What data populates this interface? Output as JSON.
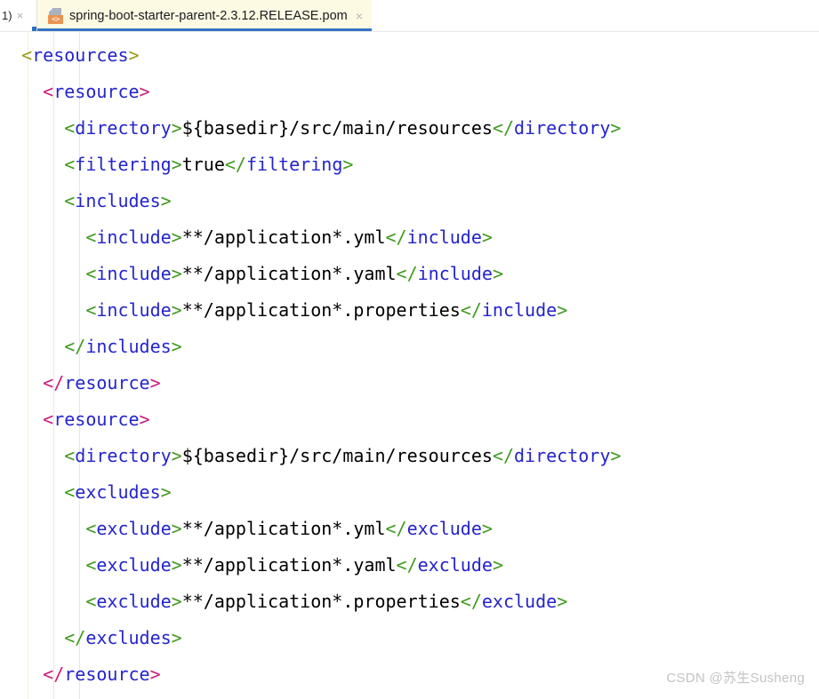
{
  "tabbar": {
    "partial_tab": {
      "label": "1)",
      "close_label": "×"
    },
    "active_tab": {
      "title": "spring-boot-starter-parent-2.3.12.RELEASE.pom",
      "icon": "xml-file-icon",
      "icon_badge": "<>",
      "close_label": "×",
      "background": "#fdfae4",
      "underline_color": "#3574c6"
    }
  },
  "editor": {
    "language": "xml",
    "colors": {
      "bracket_level0": "#9a9a18",
      "bracket_level1": "#cc1a7a",
      "bracket_level2": "#3f9a1e",
      "tag_name": "#2424cc",
      "text_content": "#000000",
      "background": "#ffffff"
    },
    "indent_guides": [
      {
        "name": "guide-level-0",
        "x": 31,
        "color": "#eff0d8"
      },
      {
        "name": "guide-level-1",
        "x": 60,
        "color": "#f5dff0"
      },
      {
        "name": "guide-level-2",
        "x": 89,
        "color": "#deeedd"
      }
    ],
    "lines": [
      {
        "indent": "",
        "open_br": "<",
        "open_tag": "resources",
        "close_br": ">",
        "level": 0
      },
      {
        "indent": "  ",
        "open_br": "<",
        "open_tag": "resource",
        "close_br": ">",
        "level": 1
      },
      {
        "indent": "    ",
        "open_br": "<",
        "open_tag": "directory",
        "close_br": ">",
        "value": "${basedir}/src/main/resources",
        "end_br_open": "</",
        "end_tag": "directory",
        "end_br_close": ">",
        "level": 2
      },
      {
        "indent": "    ",
        "open_br": "<",
        "open_tag": "filtering",
        "close_br": ">",
        "value": "true",
        "end_br_open": "</",
        "end_tag": "filtering",
        "end_br_close": ">",
        "level": 2
      },
      {
        "indent": "    ",
        "open_br": "<",
        "open_tag": "includes",
        "close_br": ">",
        "level": 2
      },
      {
        "indent": "      ",
        "open_br": "<",
        "open_tag": "include",
        "close_br": ">",
        "value": "**/application*.yml",
        "end_br_open": "</",
        "end_tag": "include",
        "end_br_close": ">",
        "level": 3
      },
      {
        "indent": "      ",
        "open_br": "<",
        "open_tag": "include",
        "close_br": ">",
        "value": "**/application*.yaml",
        "end_br_open": "</",
        "end_tag": "include",
        "end_br_close": ">",
        "level": 3
      },
      {
        "indent": "      ",
        "open_br": "<",
        "open_tag": "include",
        "close_br": ">",
        "value": "**/application*.properties",
        "end_br_open": "</",
        "end_tag": "include",
        "end_br_close": ">",
        "level": 3
      },
      {
        "indent": "    ",
        "open_br": "</",
        "open_tag": "includes",
        "close_br": ">",
        "level": 2
      },
      {
        "indent": "  ",
        "open_br": "</",
        "open_tag": "resource",
        "close_br": ">",
        "level": 1
      },
      {
        "indent": "  ",
        "open_br": "<",
        "open_tag": "resource",
        "close_br": ">",
        "level": 1
      },
      {
        "indent": "    ",
        "open_br": "<",
        "open_tag": "directory",
        "close_br": ">",
        "value": "${basedir}/src/main/resources",
        "end_br_open": "</",
        "end_tag": "directory",
        "end_br_close": ">",
        "level": 2
      },
      {
        "indent": "    ",
        "open_br": "<",
        "open_tag": "excludes",
        "close_br": ">",
        "level": 2
      },
      {
        "indent": "      ",
        "open_br": "<",
        "open_tag": "exclude",
        "close_br": ">",
        "value": "**/application*.yml",
        "end_br_open": "</",
        "end_tag": "exclude",
        "end_br_close": ">",
        "level": 3
      },
      {
        "indent": "      ",
        "open_br": "<",
        "open_tag": "exclude",
        "close_br": ">",
        "value": "**/application*.yaml",
        "end_br_open": "</",
        "end_tag": "exclude",
        "end_br_close": ">",
        "level": 3
      },
      {
        "indent": "      ",
        "open_br": "<",
        "open_tag": "exclude",
        "close_br": ">",
        "value": "**/application*.properties",
        "end_br_open": "</",
        "end_tag": "exclude",
        "end_br_close": ">",
        "level": 3
      },
      {
        "indent": "    ",
        "open_br": "</",
        "open_tag": "excludes",
        "close_br": ">",
        "level": 2
      },
      {
        "indent": "  ",
        "open_br": "</",
        "open_tag": "resource",
        "close_br": ">",
        "level": 1
      }
    ]
  },
  "watermark": {
    "text": "CSDN @苏生Susheng"
  }
}
